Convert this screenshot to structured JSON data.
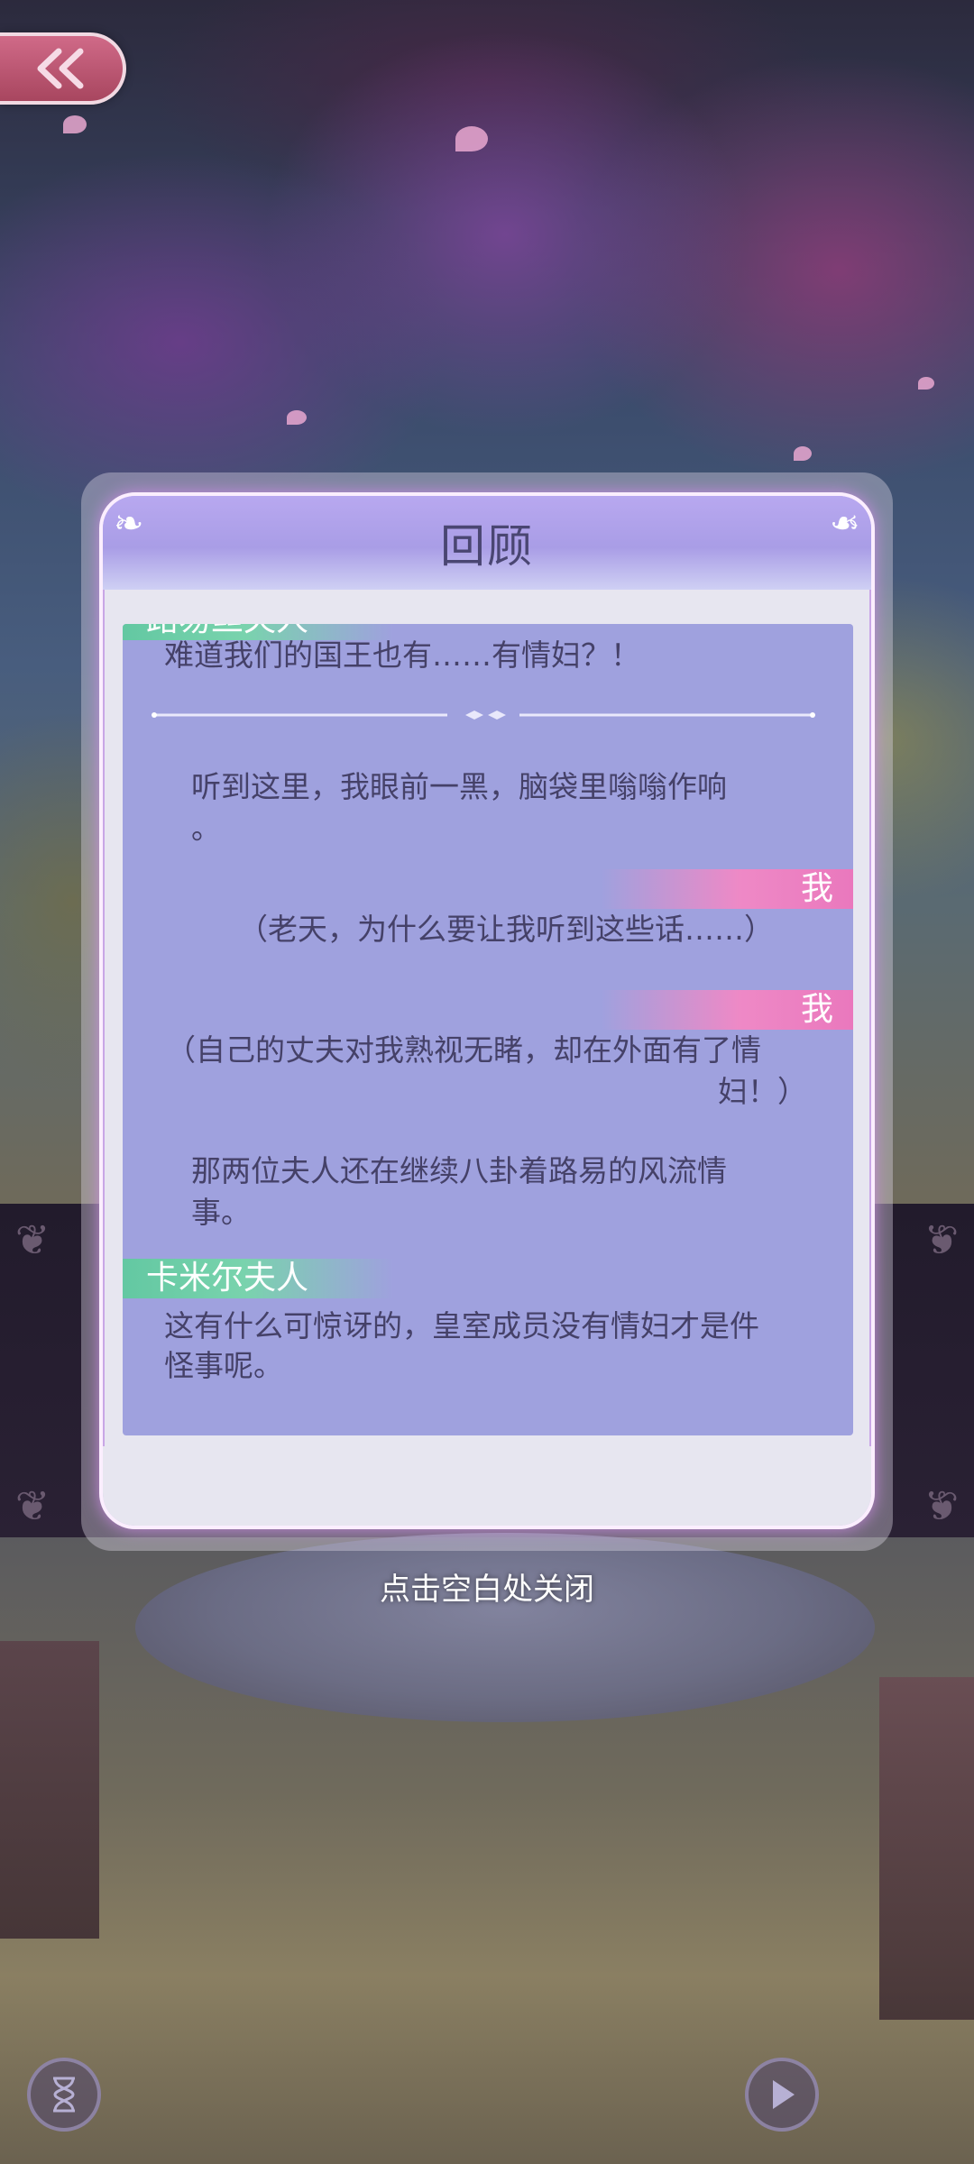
{
  "back_button": {
    "icon": "double-chevron-left-icon"
  },
  "dialog": {
    "title": "回顾",
    "entries": [
      {
        "type": "speaker-npc",
        "speaker": "路易丝夫人"
      },
      {
        "type": "line",
        "text": "难道我们的国王也有……有情妇？！"
      },
      {
        "type": "divider"
      },
      {
        "type": "narration",
        "text": "听到这里，我眼前一黑，脑袋里嗡嗡作响。"
      },
      {
        "type": "speaker-me",
        "speaker": "我"
      },
      {
        "type": "line",
        "text": "（老天，为什么要让我听到这些话……）"
      },
      {
        "type": "speaker-me",
        "speaker": "我"
      },
      {
        "type": "line",
        "text": "（自己的丈夫对我熟视无睹，却在外面有了情妇！）"
      },
      {
        "type": "narration",
        "text": "那两位夫人还在继续八卦着路易的风流情事。"
      },
      {
        "type": "speaker-npc",
        "speaker": "卡米尔夫人"
      },
      {
        "type": "line",
        "text": "这有什么可惊讶的，皇室成员没有情妇才是件怪事呢。"
      }
    ],
    "line_1a": "难道我们的国王也有……有情妇？！",
    "narration_1a": "听到这里，我眼前一黑，脑袋里嗡嗡作响",
    "narration_1b": "。",
    "speaker_me_1": "我",
    "line_2": "（老天，为什么要让我听到这些话……）",
    "speaker_me_2": "我",
    "line_3a": "（自己的丈夫对我熟视无睹，却在外面有了情",
    "line_3b": "妇！）",
    "narration_2a": "那两位夫人还在继续八卦着路易的风流情",
    "narration_2b": "事。",
    "speaker_npc_1": "路易丝夫人",
    "speaker_npc_2": "卡米尔夫人",
    "line_4a": "这有什么可惊讶的，皇室成员没有情妇才是件",
    "line_4b": "怪事呢。"
  },
  "close_hint": "点击空白处关闭",
  "bottom_controls": {
    "left": {
      "icon": "hourglass-icon"
    },
    "right": {
      "icon": "play-icon"
    }
  },
  "colors": {
    "panel": "#9fa1de",
    "npc_tag": "#63c8a2",
    "me_tag": "#ea78bd",
    "title_text": "#4a4672",
    "back_button": "#c05a78"
  }
}
